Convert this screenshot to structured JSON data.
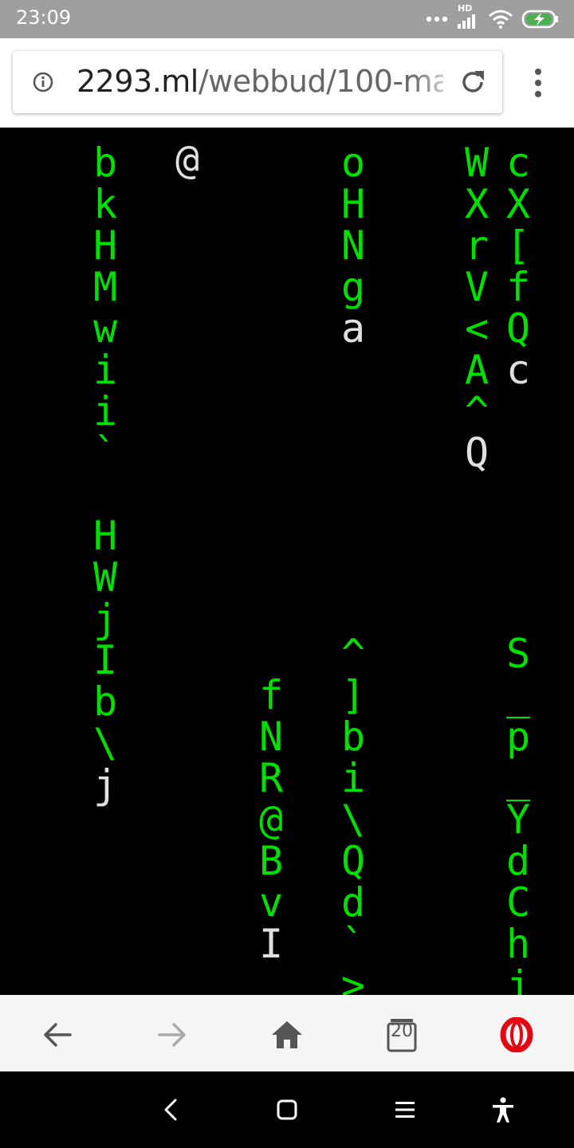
{
  "status": {
    "time": "23:09",
    "icons": [
      "more-dots-icon",
      "hd-signal-icon",
      "wifi-icon",
      "battery-charging-icon"
    ],
    "hd_label": "HD"
  },
  "address_bar": {
    "domain": "2293.ml",
    "path": "/webbud/100-ma",
    "icons": [
      "info-icon",
      "reload-icon",
      "overflow-menu-icon"
    ]
  },
  "matrix": {
    "colors": {
      "trail": "#00e000",
      "head": "#e0e0e0",
      "background": "#000000"
    },
    "columns": [
      {
        "chars": [
          "b",
          "k",
          "H",
          "M",
          "w",
          "i",
          "i",
          "`",
          " ",
          "H",
          "W",
          "j",
          "I",
          "b",
          "\\",
          "j"
        ]
      },
      {
        "chars": [
          "@"
        ]
      },
      {
        "chars": [
          "f",
          "N",
          "R",
          "@",
          "B",
          "v",
          "I"
        ]
      },
      {
        "chars": [
          "o",
          "H",
          "N",
          "g",
          "a"
        ]
      },
      {
        "chars": [
          "^",
          "]",
          "b",
          "i",
          "\\",
          "Q",
          "d",
          "`",
          ">"
        ]
      },
      {
        "chars": [
          "W",
          "X",
          "r",
          "V",
          "<",
          "A",
          "^",
          "Q"
        ]
      },
      {
        "chars": [
          "c",
          "X",
          "[",
          "f",
          "Q",
          "c"
        ]
      },
      {
        "chars": [
          "S",
          "_",
          "p",
          "_",
          "Y",
          "d",
          "C",
          "h",
          "j"
        ]
      }
    ]
  },
  "bottom_bar": {
    "tab_count": "20",
    "icons": [
      "back-arrow-icon",
      "forward-arrow-icon",
      "home-icon",
      "tabs-icon",
      "opera-logo-icon"
    ]
  },
  "system_nav": {
    "icons": [
      "system-back-icon",
      "system-home-icon",
      "system-recents-icon",
      "accessibility-icon"
    ]
  }
}
